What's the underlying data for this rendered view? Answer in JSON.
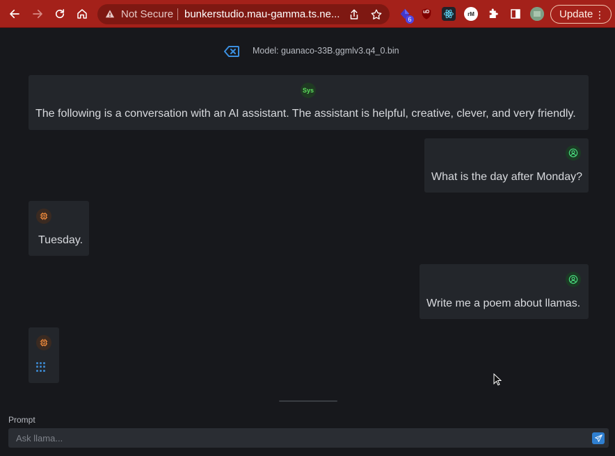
{
  "browser": {
    "security_label": "Not Secure",
    "url": "bunkerstudio.mau-gamma.ts.ne...",
    "extension_badge": "6",
    "update_label": "Update",
    "ext_ublock": "uD",
    "ext_rm": "rM"
  },
  "header": {
    "model_label": "Model: guanaco-33B.ggmlv3.q4_0.bin"
  },
  "messages": [
    {
      "role": "system",
      "avatar": "Sys",
      "text": "The following is a conversation with an AI assistant. The assistant is helpful, creative, clever, and very friendly."
    },
    {
      "role": "user",
      "avatar": "user-icon",
      "text": "What is the day after Monday?"
    },
    {
      "role": "assistant",
      "avatar": "chip-icon",
      "text": "Tuesday."
    },
    {
      "role": "user",
      "avatar": "user-icon",
      "text": "Write me a poem about llamas."
    },
    {
      "role": "assistant",
      "avatar": "chip-icon",
      "text": ""
    }
  ],
  "prompt": {
    "label": "Prompt",
    "placeholder": "Ask llama..."
  },
  "colors": {
    "chrome": "#a4211a",
    "background": "#17181c",
    "bubble": "#23262b",
    "accent": "#2f7fd0"
  }
}
